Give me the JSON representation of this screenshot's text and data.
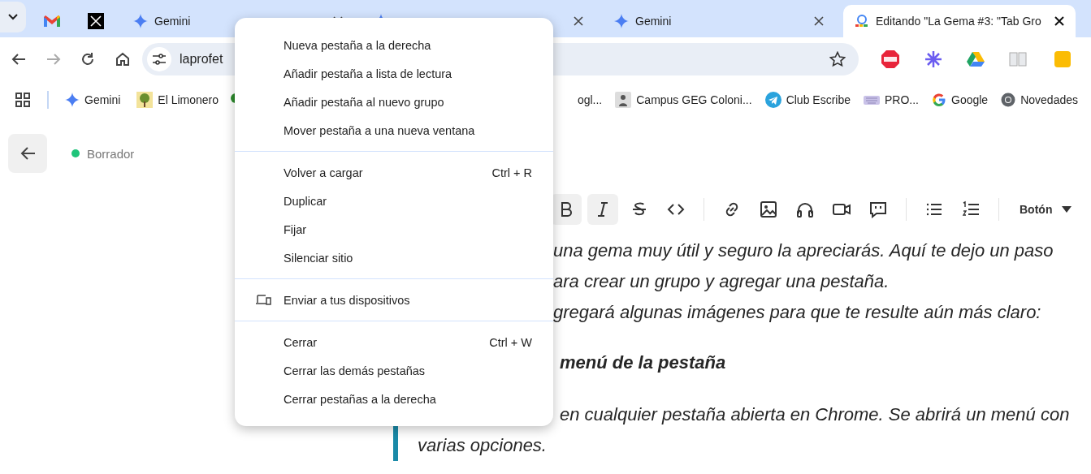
{
  "tabs": [
    {
      "kind": "mail",
      "selected": false
    },
    {
      "kind": "x",
      "selected": false
    },
    {
      "kind": "gemini",
      "title": "Gemini",
      "selected": false
    },
    {
      "kind": "gemini",
      "selected": false
    },
    {
      "kind": "gemini",
      "title": "Gemini",
      "selected": false
    },
    {
      "kind": "doc",
      "title": "Editando \"La Gema #3: \"Tab Gro",
      "selected": true
    }
  ],
  "address_bar": {
    "value": "laprofet"
  },
  "bookmarks_left": [
    {
      "kind": "gemini",
      "label": "Gemini"
    },
    {
      "kind": "photo",
      "label": "El Limonero"
    },
    {
      "kind": "tree"
    }
  ],
  "bookmarks_right": [
    {
      "kind": "none",
      "label": "ogl..."
    },
    {
      "kind": "campus",
      "label": "Campus GEG Coloni..."
    },
    {
      "kind": "telegram",
      "label": "Club Escribe"
    },
    {
      "kind": "keyboard",
      "label": "PRO..."
    },
    {
      "kind": "google",
      "label": "Google"
    },
    {
      "kind": "chrome",
      "label": "Novedades"
    }
  ],
  "post_status": {
    "label": "Borrador",
    "color": "#1fc47a"
  },
  "editor_toolbar": [
    {
      "kind": "bold",
      "active": true
    },
    {
      "kind": "italic",
      "active": true
    },
    {
      "kind": "strike",
      "active": false
    },
    {
      "kind": "code",
      "active": false
    },
    {
      "kind": "sep"
    },
    {
      "kind": "link",
      "active": false
    },
    {
      "kind": "image",
      "active": false
    },
    {
      "kind": "audio",
      "active": false
    },
    {
      "kind": "video",
      "active": false
    },
    {
      "kind": "quote",
      "active": false
    },
    {
      "kind": "sep"
    },
    {
      "kind": "bullets",
      "active": false
    },
    {
      "kind": "numbers",
      "active": false
    },
    {
      "kind": "sep"
    },
    {
      "kind": "dropdown",
      "label": "Botón"
    }
  ],
  "content": [
    {
      "kind": "text",
      "text": "una gema muy útil y seguro la apreciarás. Aquí te dejo un paso"
    },
    {
      "kind": "text",
      "text": "ara crear un grupo y agregar una pestaña."
    },
    {
      "kind": "text",
      "text": "gregará algunas imágenes para que te resulte aún más claro:"
    },
    {
      "kind": "heading",
      "text": "menú de la pestaña"
    },
    {
      "kind": "quote",
      "lines": [
        "en cualquier pestaña abierta en Chrome. Se abrirá un menú con",
        "varias opciones."
      ]
    }
  ],
  "context_menu": [
    [
      {
        "label": "Nueva pestaña a la derecha"
      },
      {
        "label": "Añadir pestaña a lista de lectura"
      },
      {
        "label": "Añadir pestaña al nuevo grupo"
      },
      {
        "label": "Mover pestaña a una nueva ventana"
      }
    ],
    [
      {
        "label": "Volver a cargar",
        "shortcut": "Ctrl + R"
      },
      {
        "label": "Duplicar"
      },
      {
        "label": "Fijar"
      },
      {
        "label": "Silenciar sitio"
      }
    ],
    [
      {
        "label": "Enviar a tus dispositivos",
        "kind": "devices"
      }
    ],
    [
      {
        "label": "Cerrar",
        "shortcut": "Ctrl + W"
      },
      {
        "label": "Cerrar las demás pestañas"
      },
      {
        "label": "Cerrar pestañas a la derecha"
      }
    ]
  ]
}
